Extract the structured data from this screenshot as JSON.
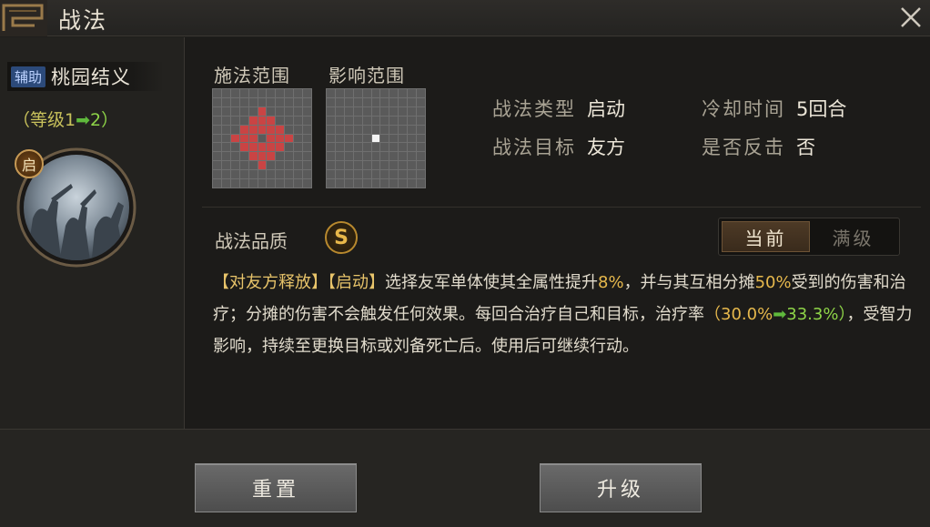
{
  "window": {
    "title": "战法"
  },
  "skill": {
    "type_tag": "辅助",
    "name": "桃园结义",
    "level_prefix": "（等级1",
    "level_next": "2）",
    "start_badge": "启"
  },
  "ranges": {
    "cast_label": "施法范围",
    "effect_label": "影响范围"
  },
  "stats": {
    "type_key": "战法类型",
    "type_val": "启动",
    "cooldown_key": "冷却时间",
    "cooldown_val": "5回合",
    "target_key": "战法目标",
    "target_val": "友方",
    "counter_key": "是否反击",
    "counter_val": "否"
  },
  "quality": {
    "label": "战法品质",
    "grade": "S"
  },
  "toggle": {
    "current": "当前",
    "max": "满级",
    "active": "current"
  },
  "description": {
    "tag1": "【对友方释放】",
    "tag2": "【启动】",
    "part1": "选择友军单体使其全属性提升",
    "pct1": "8%",
    "part2": "，并与其互相分摊",
    "pct2": "50%",
    "part3": "受到的伤害和治疗；分摊的伤害不会触发任何效果。每回合治疗自己和目标，治疗率",
    "rate_from": "（30.0%",
    "rate_to": "33.3%）",
    "part4": "，受智力影响，持续至更换目标或刘备死亡后。使用后可继续行动。"
  },
  "buttons": {
    "reset": "重置",
    "upgrade": "升级"
  },
  "colors": {
    "cast_cells": "#c94444",
    "effect_cell": "#f4f4f4",
    "accent": "#e6b84c",
    "increase": "#8ed448"
  },
  "icons": {
    "close": "close-icon",
    "arrow": "arrow-right-icon"
  }
}
